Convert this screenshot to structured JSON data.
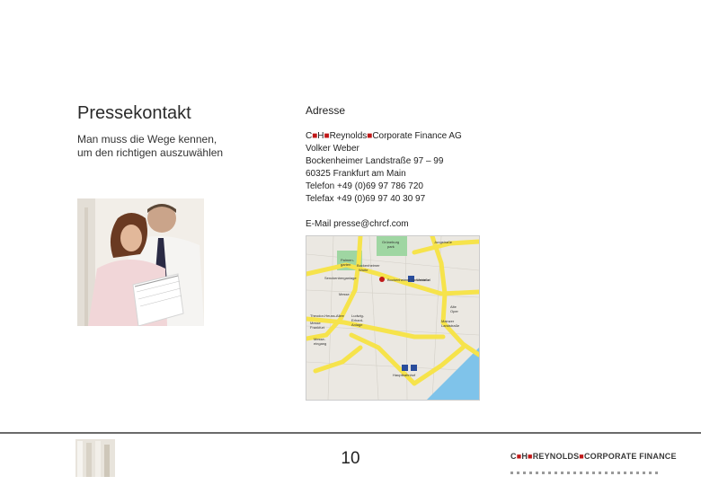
{
  "left": {
    "heading": "Pressekontakt",
    "subtitle_lines": [
      "Man muss die Wege kennen,",
      "um den richtigen auszuwählen"
    ]
  },
  "address": {
    "heading": "Adresse",
    "company_prefix": "C",
    "company_h": "H",
    "company_name": "Reynolds",
    "company_suffix": "Corporate Finance AG",
    "lines": [
      "Volker Weber",
      "Bockenheimer Landstraße 97 – 99",
      "60325 Frankfurt am Main",
      "Telefon +49 (0)69 97 786 720",
      "Telefax +49 (0)69 97 40 30 97"
    ],
    "email": "E-Mail presse@chrcf.com"
  },
  "footer": {
    "page_number": "10",
    "brand": {
      "c": "C",
      "h": "H",
      "reynolds": "REYNOLDS",
      "cf": "CORPORATE FINANCE"
    }
  },
  "colors": {
    "accent_red": "#c01818",
    "map_road": "#f6e34b",
    "map_park": "#9fd6a2",
    "map_water": "#7fc3ea"
  }
}
